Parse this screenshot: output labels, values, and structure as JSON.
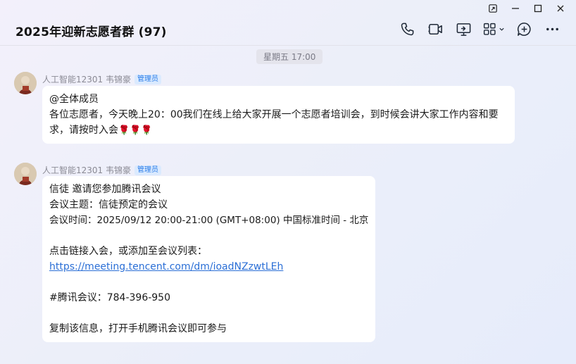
{
  "window": {
    "title": "2025年迎新志愿者群 (97)"
  },
  "toolbar": {
    "icons": [
      "phone-icon",
      "video-call-icon",
      "screen-share-icon",
      "apps-icon",
      "add-icon",
      "more-icon"
    ]
  },
  "timestamp": "星期五 17:00",
  "messages": [
    {
      "sender": "人工智能12301 韦锦豪",
      "role": "管理员",
      "lines": {
        "l1": "@全体成员",
        "l2": "各位志愿者，今天晚上20：00我们在线上给大家开展一个志愿者培训会，到时候会讲大家工作内容和要求，请按时入会",
        "emoji": "🌹🌹🌹"
      }
    },
    {
      "sender": "人工智能12301 韦锦豪",
      "role": "管理员",
      "lines": {
        "l1": "信徒 邀请您参加腾讯会议",
        "l2": "会议主题：信徒预定的会议",
        "l3": "会议时间：2025/09/12 20:00-21:00 (GMT+08:00) 中国标准时间 - 北京",
        "l4": "点击链接入会，或添加至会议列表：",
        "link": "https://meeting.tencent.com/dm/ioadNZzwtLEh",
        "l5": "#腾讯会议：784-396-950",
        "l6": "复制该信息，打开手机腾讯会议即可参与"
      }
    }
  ],
  "colors": {
    "accent": "#2b7de9",
    "link": "#2b6fd6",
    "bubble": "#ffffff"
  }
}
